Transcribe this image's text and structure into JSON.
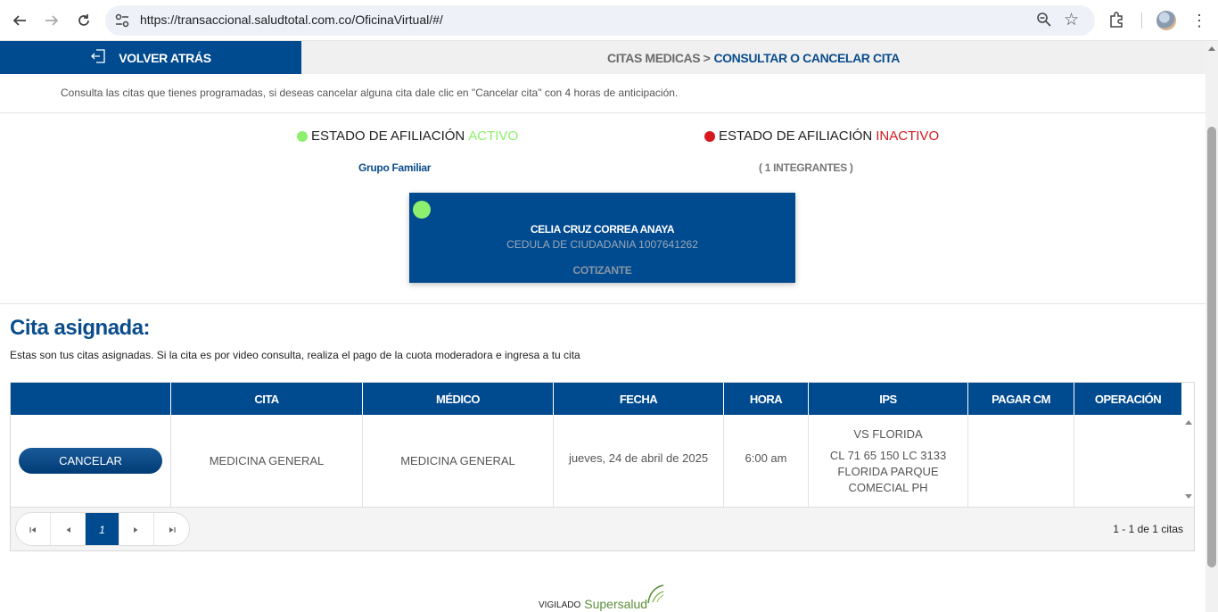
{
  "browser": {
    "url": "https://transaccional.saludtotal.com.co/OficinaVirtual/#/"
  },
  "topbar": {
    "back_label": "VOLVER ATRÁS",
    "crumb_parent": "CITAS MEDICAS >",
    "crumb_current": "CONSULTAR O CANCELAR CITA"
  },
  "intro": "Consulta las citas que tienes programadas, si deseas cancelar alguna cita dale clic en \"Cancelar cita\" con 4 horas de anticipación.",
  "status": {
    "active_prefix": "ESTADO DE AFILIACIÓN",
    "active_word": "ACTIVO",
    "inactive_prefix": "ESTADO DE AFILIACIÓN",
    "inactive_word": "INACTIVO",
    "active_color": "#8cf06e",
    "inactive_color": "#d71920"
  },
  "family": {
    "label": "Grupo Familiar",
    "members": "( 1 INTEGRANTES )"
  },
  "member_card": {
    "name": "CELIA CRUZ CORREA ANAYA",
    "document": "CEDULA DE CIUDADANIA 1007641262",
    "role": "COTIZANTE"
  },
  "appointments": {
    "title": "Cita asignada:",
    "subtitle": "Estas son tus citas asignadas. Si la cita es por video consulta, realiza el pago de la cuota moderadora e ingresa a tu cita",
    "columns": [
      "",
      "CITA",
      "MÉDICO",
      "FECHA",
      "HORA",
      "IPS",
      "PAGAR CM",
      "OPERACIÓN"
    ],
    "rows": [
      {
        "action": "CANCELAR",
        "cita": "MEDICINA GENERAL",
        "medico": "MEDICINA GENERAL",
        "fecha": "jueves, 24 de abril de 2025",
        "hora": "6:00 am",
        "ips_name": "VS FLORIDA",
        "ips_address": "CL 71 65 150 LC 3133 FLORIDA PARQUE COMECIAL PH",
        "pagar_cm": "",
        "operacion": ""
      }
    ],
    "pager": {
      "current_page": "1",
      "info": "1 - 1 de 1 citas"
    }
  },
  "footer": {
    "vigilado": "VIGILADO",
    "brand": "Supersalud"
  }
}
